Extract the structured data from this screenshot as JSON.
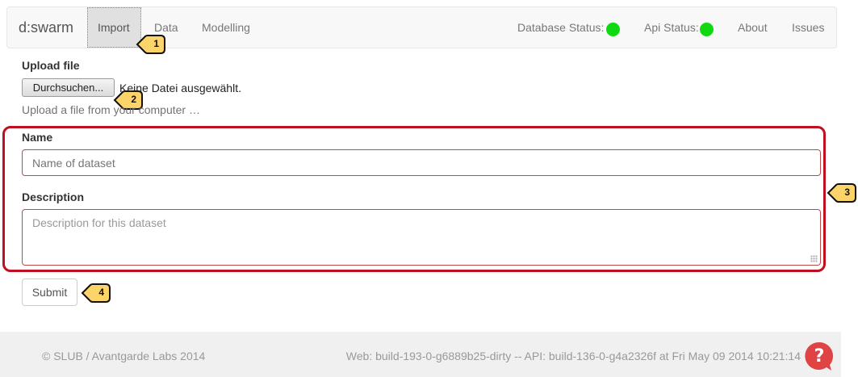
{
  "navbar": {
    "brand": "d:swarm",
    "tabs": [
      {
        "label": "Import"
      },
      {
        "label": "Data"
      },
      {
        "label": "Modelling"
      }
    ],
    "database_status_label": "Database Status:",
    "api_status_label": "Api Status:",
    "about": "About",
    "issues": "Issues",
    "status_color": "#11d911"
  },
  "callouts": [
    "1",
    "2",
    "3",
    "4"
  ],
  "upload": {
    "label": "Upload file",
    "button": "Durchsuchen...",
    "status": "Keine Datei ausgewählt.",
    "help": "Upload a file from your computer …"
  },
  "form": {
    "name_label": "Name",
    "name_placeholder": "Name of dataset",
    "description_label": "Description",
    "description_placeholder": "Description for this dataset",
    "submit": "Submit",
    "highlight_color": "#c00f1e"
  },
  "footer": {
    "copyright": "© SLUB / Avantgarde Labs 2014",
    "build": "Web: build-193-0-g6889b25-dirty -- API: build-136-0-g4a2326f at Fri May 09 2014 10:21:14"
  }
}
